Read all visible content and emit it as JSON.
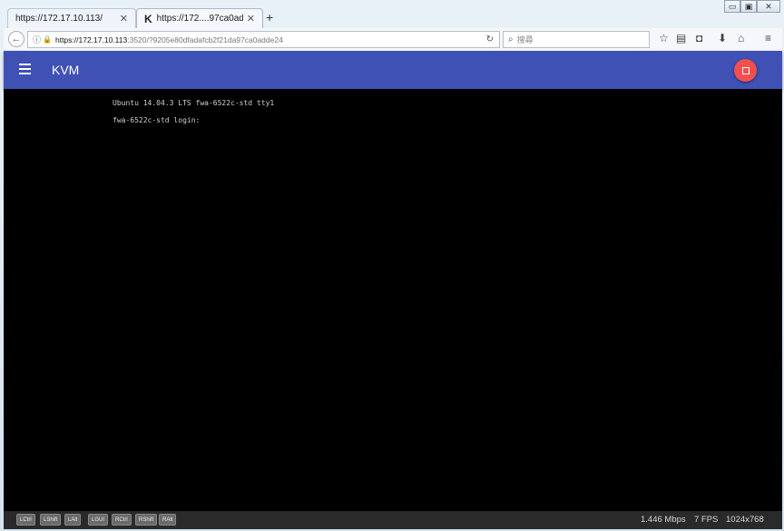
{
  "browser": {
    "tabs": [
      {
        "title": "https://172.17.10.113/",
        "active": false
      },
      {
        "title": "https://172....97ca0adde24",
        "active": true,
        "favicon_letter": "K"
      }
    ],
    "new_tab_label": "+",
    "window_controls": {
      "minimize": "▭",
      "maximize": "▣",
      "close": "✕"
    },
    "address": {
      "host": "https://172.17.10.113",
      "rest": ":3520/?9205e80dfadafcb2f21da97ca0adde24"
    },
    "search_placeholder": "搜尋",
    "toolbar_icons": [
      "star-icon",
      "reader-icon",
      "pocket-icon",
      "download-icon",
      "home-icon",
      "menu-icon"
    ]
  },
  "app": {
    "title": "KVM",
    "accent_color": "#3f51b5",
    "fab_color": "#f44f4f",
    "console_lines": [
      "Ubuntu 14.04.3 LTS fwa-6522c-std tty1",
      "fwa-6522c-std login:"
    ],
    "keys": [
      "LCtrl",
      "LShift",
      "LAlt",
      "LGUI",
      "RCtrl",
      "RShift",
      "RAlt"
    ],
    "status": {
      "bitrate": "1.446 Mbps",
      "fps": "7 FPS",
      "resolution": "1024x768"
    }
  }
}
